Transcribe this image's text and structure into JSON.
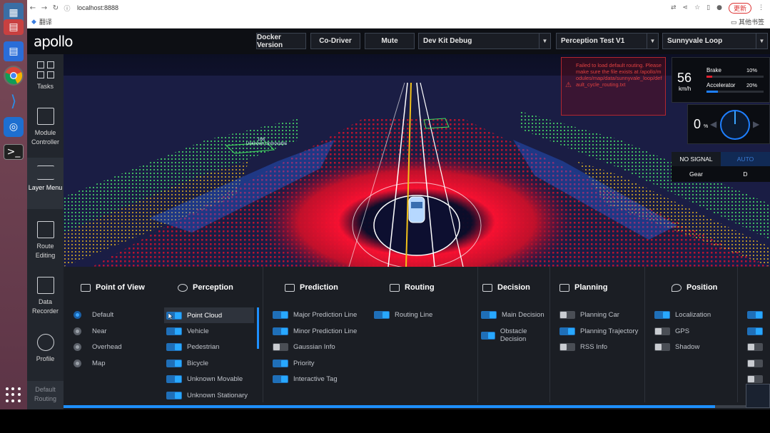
{
  "browser": {
    "url": "localhost:8888",
    "translate": "翻译",
    "other_bookmarks": "其他书签",
    "update_button": "更新"
  },
  "header": {
    "logo": "apollo",
    "docker_version": "Docker Version",
    "co_driver": "Co-Driver",
    "mute": "Mute",
    "mode_select": "Dev Kit Debug",
    "vehicle_select": "Perception Test V1",
    "map_select": "Sunnyvale Loop"
  },
  "sidebar": {
    "items": [
      {
        "label": "Tasks",
        "icon": "grid-icon"
      },
      {
        "label": "Module Controller",
        "icon": "sliders-icon"
      },
      {
        "label": "Layer Menu",
        "icon": "layers-icon"
      },
      {
        "label": "Route Editing",
        "icon": "route-icon"
      },
      {
        "label": "Data Recorder",
        "icon": "recorder-icon"
      },
      {
        "label": "Profile",
        "icon": "hexagon-icon"
      },
      {
        "label": "Default Routing",
        "icon": ""
      }
    ]
  },
  "alert": {
    "text": "Failed to load default routing. Please make sure the file exists at /apollo/modules/map/data/sunnyvale_loop/default_cycle_routing.txt"
  },
  "dashboard": {
    "speed": "56",
    "speed_unit": "km/h",
    "brake_label": "Brake",
    "brake_value": "10%",
    "brake_fraction": 0.1,
    "accel_label": "Accelerator",
    "accel_value": "20%",
    "accel_fraction": 0.2,
    "steering_value": "0",
    "steering_unit": "%",
    "signal": "NO SIGNAL",
    "driving_mode": "AUTO",
    "gear_label": "Gear",
    "gear_value": "D"
  },
  "scene": {
    "obstacle_label_1": "166",
    "obstacle_label_2": "Unknown Unmovable"
  },
  "layers": {
    "point_of_view": {
      "title": "Point of View",
      "options": [
        "Default",
        "Near",
        "Overhead",
        "Map"
      ],
      "selected": "Default"
    },
    "perception": {
      "title": "Perception",
      "items": [
        "Point Cloud",
        "Vehicle",
        "Pedestrian",
        "Bicycle",
        "Unknown Movable",
        "Unknown Stationary"
      ],
      "states": [
        true,
        true,
        true,
        true,
        true,
        true
      ]
    },
    "prediction": {
      "title": "Prediction",
      "items": [
        "Major Prediction Line",
        "Minor Prediction Line",
        "Gaussian Info",
        "Priority",
        "Interactive Tag"
      ],
      "states": [
        true,
        true,
        false,
        true,
        true
      ]
    },
    "routing": {
      "title": "Routing",
      "items": [
        "Routing Line"
      ],
      "states": [
        true
      ]
    },
    "decision": {
      "title": "Decision",
      "items": [
        "Main Decision",
        "Obstacle Decision"
      ],
      "states": [
        true,
        true
      ]
    },
    "planning": {
      "title": "Planning",
      "items": [
        "Planning Car",
        "Planning Trajectory",
        "RSS Info"
      ],
      "states": [
        false,
        true,
        false
      ]
    },
    "position": {
      "title": "Position",
      "items": [
        "Localization",
        "GPS",
        "Shadow"
      ],
      "states": [
        true,
        false,
        false
      ]
    }
  },
  "playback_progress": 0.922
}
